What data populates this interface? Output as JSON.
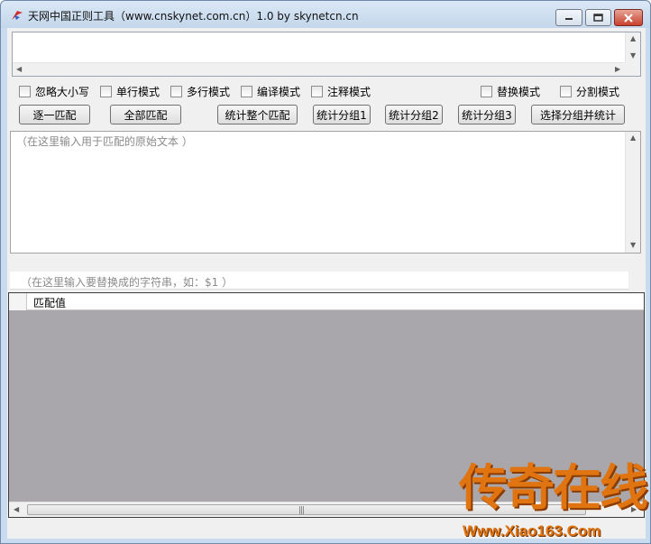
{
  "window": {
    "title": "天网中国正则工具（www.cnskynet.com.cn）1.0 by skynetcn.cn"
  },
  "options": {
    "ignore_case": "忽略大小写",
    "single_line": "单行模式",
    "multi_line": "多行模式",
    "compiled": "编译模式",
    "comment": "注释模式",
    "replace": "替换模式",
    "split": "分割模式"
  },
  "buttons": {
    "match_next": "逐一匹配",
    "match_all": "全部匹配",
    "count_whole": "统计整个匹配",
    "count_group1": "统计分组1",
    "count_group2": "统计分组2",
    "count_group3": "统计分组3",
    "select_group_count": "选择分组并统计"
  },
  "source": {
    "placeholder": "（在这里输入用于匹配的原始文本 ）"
  },
  "replacement": {
    "placeholder": "（在这里输入要替换成的字符串，如：$1 ）"
  },
  "grid": {
    "columns": [
      "匹配值"
    ]
  },
  "watermark": {
    "text": "传奇在线",
    "url": "Www.Xiao163.Com"
  },
  "colors": {
    "titlebar": "#c9dbee",
    "grid_background": "#a9a7ab",
    "watermark": "#e07410",
    "close_button": "#c8402c"
  }
}
